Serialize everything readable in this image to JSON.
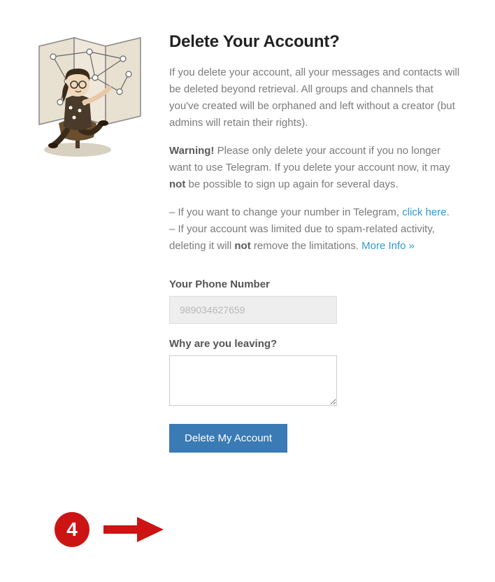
{
  "heading": "Delete Your Account?",
  "intro": "If you delete your account, all your messages and contacts will be deleted beyond retrieval. All groups and channels that you've created will be orphaned and left without a creator (but admins will retain their rights).",
  "warning": {
    "label": "Warning!",
    "before": " Please only delete your account if you no longer want to use Telegram. If you delete your account now, it may ",
    "bold": "not",
    "after": " be possible to sign up again for several days."
  },
  "bullet1": {
    "before": "– If you want to change your number in Telegram, ",
    "link": "click here",
    "after": "."
  },
  "bullet2": {
    "before": "– If your account was limited due to spam-related activity, deleting it will ",
    "bold": "not",
    "after": " remove the limitations. ",
    "link": "More Info »"
  },
  "form": {
    "phone_label": "Your Phone Number",
    "phone_value": "989034627659",
    "reason_label": "Why are you leaving?",
    "reason_value": "",
    "submit_label": "Delete My Account"
  },
  "annotation": {
    "step": "4"
  }
}
